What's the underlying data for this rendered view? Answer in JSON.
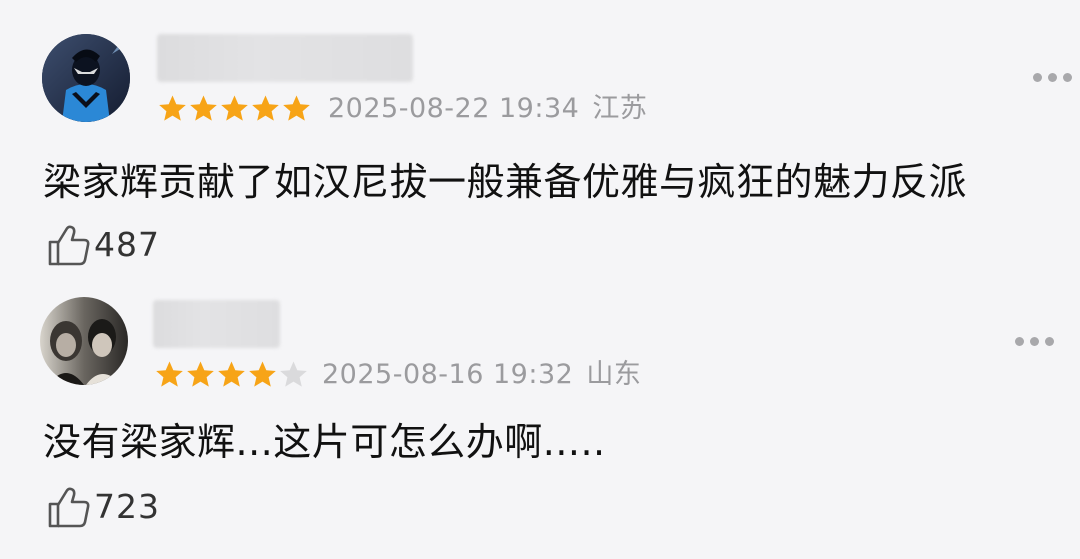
{
  "comments": [
    {
      "rating": 5,
      "date": "2025-08-22 19:34",
      "location": "江苏",
      "text": "梁家辉贡献了如汉尼拔一般兼备优雅与疯狂的魅力反派",
      "likes": "487"
    },
    {
      "rating": 4,
      "date": "2025-08-16 19:32",
      "location": "山东",
      "text": "没有梁家辉...这片可怎么办啊.....",
      "likes": "723"
    }
  ],
  "colors": {
    "star_filled": "#f7a417",
    "star_empty": "#dadadc",
    "meta_text": "#9b9b9e",
    "background": "#f5f5f7"
  },
  "icons": {
    "more": "more-dots-icon",
    "like": "thumbs-up-icon",
    "star": "star-icon"
  }
}
